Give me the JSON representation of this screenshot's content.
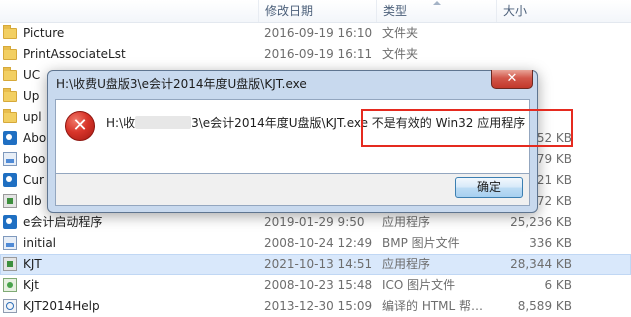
{
  "columns": {
    "name": "",
    "date": "修改日期",
    "type": "类型",
    "size": "大小"
  },
  "files": [
    {
      "name": "Picture",
      "date": "2016-09-19 16:10",
      "type": "文件夹",
      "size": "",
      "icon": "folder-icon"
    },
    {
      "name": "PrintAssociateLst",
      "date": "2016-09-19 16:11",
      "type": "文件夹",
      "size": "",
      "icon": "folder-icon"
    },
    {
      "name": "UC",
      "date": "",
      "type": "",
      "size": "",
      "icon": "folder-icon"
    },
    {
      "name": "Up",
      "date": "",
      "type": "",
      "size": "",
      "icon": "folder-icon"
    },
    {
      "name": "upl",
      "date": "",
      "type": "",
      "size": "",
      "icon": "folder-icon"
    },
    {
      "name": "Abo",
      "date": "",
      "type": "",
      "size": "52 KB",
      "icon": "app-icon"
    },
    {
      "name": "boo",
      "date": "",
      "type": "",
      "size": "79 KB",
      "icon": "bmp-icon"
    },
    {
      "name": "Cur",
      "date": "",
      "type": "",
      "size": "21 KB",
      "icon": "app-icon"
    },
    {
      "name": "dlb",
      "date": "",
      "type": "",
      "size": "72 KB",
      "icon": "kjt-icon"
    },
    {
      "name": "e会计启动程序",
      "date": "2019-01-29 9:50",
      "type": "应用程序",
      "size": "25,236 KB",
      "icon": "app-icon"
    },
    {
      "name": "initial",
      "date": "2008-10-24 12:49",
      "type": "BMP 图片文件",
      "size": "336 KB",
      "icon": "bmp-icon"
    },
    {
      "name": "KJT",
      "date": "2021-10-13 14:51",
      "type": "应用程序",
      "size": "28,344 KB",
      "icon": "kjt-icon",
      "selected": true
    },
    {
      "name": "Kjt",
      "date": "2008-10-23 15:48",
      "type": "ICO 图片文件",
      "size": "6 KB",
      "icon": "ico-file-icon"
    },
    {
      "name": "KJT2014Help",
      "date": "2013-12-30 15:09",
      "type": "编译的 HTML 帮…",
      "size": "8,589 KB",
      "icon": "html-icon"
    }
  ],
  "dialog": {
    "title": "H:\\收费U盘版3\\e会计2014年度U盘版\\KJT.exe",
    "close_label": "✕",
    "message_prefix": "H:\\收",
    "message_middle": "3\\e会计2014年度U盘版\\",
    "message_highlight": "KJT.exe 不是有效的 Win32 应用程序",
    "ok_label": "确定",
    "error_glyph": "✕"
  },
  "colors": {
    "highlight_border": "#e52a1f",
    "dialog_frame": "#c8d9ee",
    "selected_row": "#d9e8fb"
  }
}
